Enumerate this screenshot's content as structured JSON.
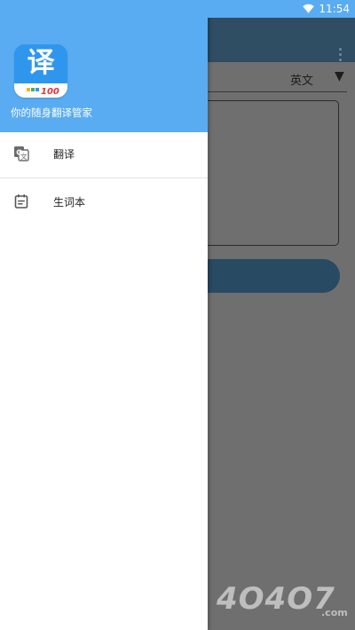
{
  "status_bar": {
    "time": "11:54",
    "wifi_icon": "wifi-icon",
    "background": "#5aacf2"
  },
  "drawer": {
    "header_background": "#5aacf2",
    "app_logo": {
      "glyph": "译",
      "number": "100"
    },
    "tagline": "你的随身翻译管家",
    "menu": [
      {
        "label": "翻译",
        "icon": "translate-icon"
      },
      {
        "label": "生词本",
        "icon": "notebook-icon"
      }
    ]
  },
  "app": {
    "toolbar_color": "#2f4d63",
    "target_language": "英文",
    "translate_button_color": "#284a63"
  },
  "watermark": {
    "text": "4O4O7",
    "sub": ".com"
  }
}
